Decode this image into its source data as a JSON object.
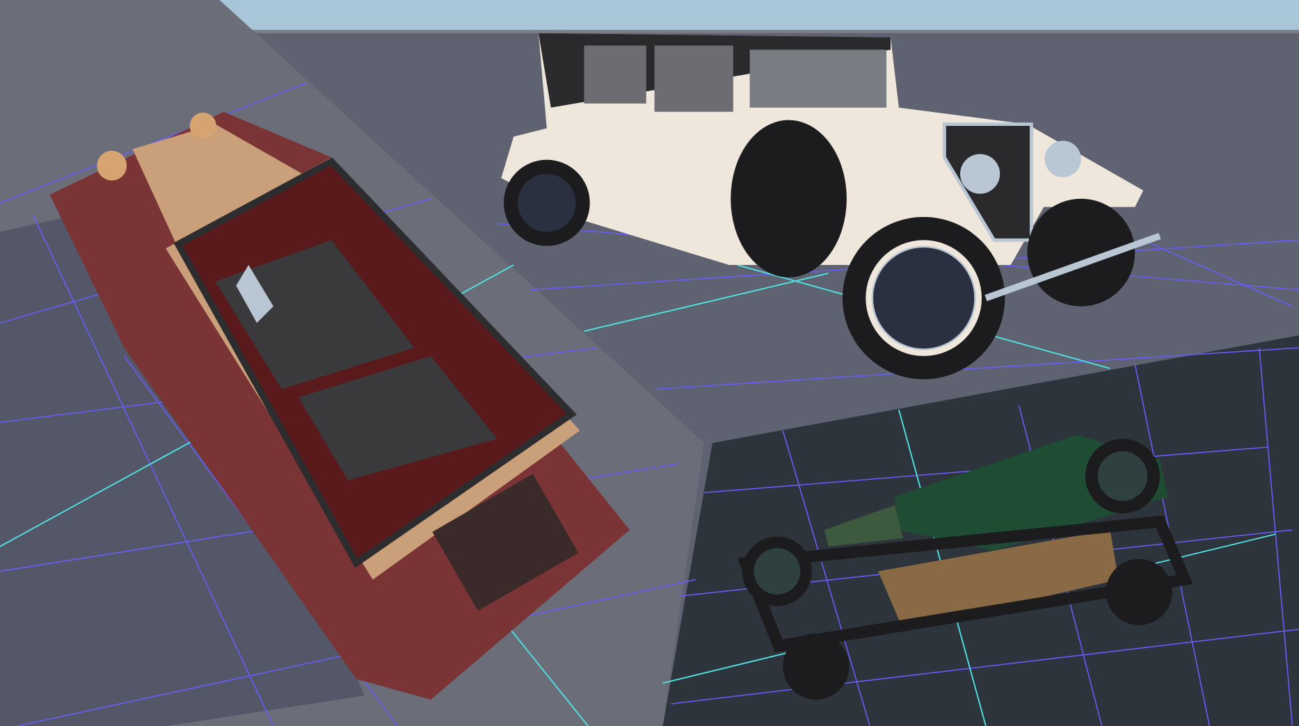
{
  "scene": {
    "colors": {
      "sky": "#a9c6d8",
      "ground": "#5f6270",
      "tilted_plane": "#6b6d79",
      "dark_plane": "#2e343c",
      "shadow": "#4a4e60",
      "grid_major": "#6a5cff",
      "grid_axis": "#4fe0e0",
      "maroon_car_body": "#7a3436",
      "maroon_car_tan": "#c9a079",
      "maroon_car_interior": "#5a1a1c",
      "white_car_body": "#efe6dc",
      "white_car_roof": "#2a2a2c",
      "green_car_body": "#1f4d34",
      "green_car_chassis": "#8a6a45",
      "tire": "#1c1c1e",
      "chrome": "#b9c6d4"
    },
    "objects": [
      "maroon-touring-car",
      "white-sedan-car",
      "green-car-upside-down"
    ]
  }
}
